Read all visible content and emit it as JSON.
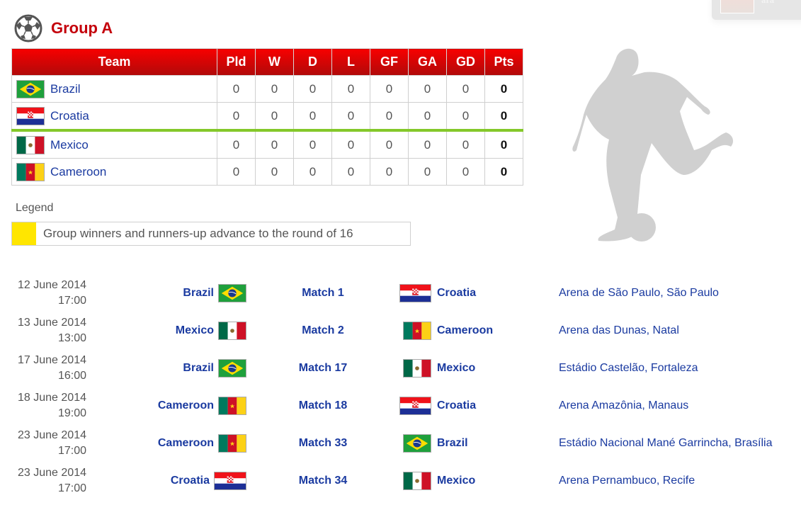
{
  "group": {
    "title": "Group A",
    "icon": "soccer-ball-icon"
  },
  "colors": {
    "title_red": "#c4000b",
    "header_red": "#e00000",
    "link_blue": "#1a3aa0",
    "qualify_line": "#84c82a",
    "legend_yellow": "#ffe600",
    "silhouette": "#d0d0d0"
  },
  "standings": {
    "columns": [
      "Team",
      "Pld",
      "W",
      "D",
      "L",
      "GF",
      "GA",
      "GD",
      "Pts"
    ],
    "rows": [
      {
        "team": "Brazil",
        "flag": "brazil-flag",
        "pld": "0",
        "w": "0",
        "d": "0",
        "l": "0",
        "gf": "0",
        "ga": "0",
        "gd": "0",
        "pts": "0"
      },
      {
        "team": "Croatia",
        "flag": "croatia-flag",
        "pld": "0",
        "w": "0",
        "d": "0",
        "l": "0",
        "gf": "0",
        "ga": "0",
        "gd": "0",
        "pts": "0"
      },
      {
        "team": "Mexico",
        "flag": "mexico-flag",
        "pld": "0",
        "w": "0",
        "d": "0",
        "l": "0",
        "gf": "0",
        "ga": "0",
        "gd": "0",
        "pts": "0"
      },
      {
        "team": "Cameroon",
        "flag": "cameroon-flag",
        "pld": "0",
        "w": "0",
        "d": "0",
        "l": "0",
        "gf": "0",
        "ga": "0",
        "gd": "0",
        "pts": "0"
      }
    ]
  },
  "legend": {
    "title": "Legend",
    "items": [
      {
        "color": "#ffe600",
        "text": "Group winners and runners-up advance to the round of 16"
      }
    ]
  },
  "faded_card": {
    "text": "ara"
  },
  "matches": [
    {
      "date": "12 June 2014",
      "time": "17:00",
      "home": "Brazil",
      "home_flag": "brazil",
      "match": "Match 1",
      "away": "Croatia",
      "away_flag": "croatia",
      "venue": "Arena de São Paulo, São Paulo"
    },
    {
      "date": "13 June 2014",
      "time": "13:00",
      "home": "Mexico",
      "home_flag": "mexico",
      "match": "Match 2",
      "away": "Cameroon",
      "away_flag": "cameroon",
      "venue": "Arena das Dunas, Natal"
    },
    {
      "date": "17 June 2014",
      "time": "16:00",
      "home": "Brazil",
      "home_flag": "brazil",
      "match": "Match 17",
      "away": "Mexico",
      "away_flag": "mexico",
      "venue": "Estádio Castelão, Fortaleza"
    },
    {
      "date": "18 June 2014",
      "time": "19:00",
      "home": "Cameroon",
      "home_flag": "cameroon",
      "match": "Match 18",
      "away": "Croatia",
      "away_flag": "croatia",
      "venue": "Arena Amazônia, Manaus"
    },
    {
      "date": "23 June 2014",
      "time": "17:00",
      "home": "Cameroon",
      "home_flag": "cameroon",
      "match": "Match 33",
      "away": "Brazil",
      "away_flag": "brazil",
      "venue": "Estádio Nacional Mané Garrincha, Brasília"
    },
    {
      "date": "23 June 2014",
      "time": "17:00",
      "home": "Croatia",
      "home_flag": "croatia",
      "match": "Match 34",
      "away": "Mexico",
      "away_flag": "mexico",
      "venue": "Arena Pernambuco, Recife"
    }
  ]
}
